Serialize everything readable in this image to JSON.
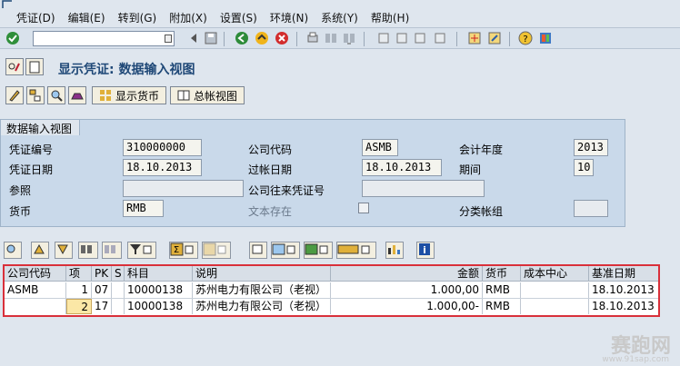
{
  "menu": [
    "凭证(D)",
    "编辑(E)",
    "转到(G)",
    "附加(X)",
    "设置(S)",
    "环境(N)",
    "系统(Y)",
    "帮助(H)"
  ],
  "command_field": {
    "value": ""
  },
  "title": "显示凭证: 数据输入视图",
  "app_toolbar": {
    "display_currency_label": "显示货币",
    "general_ledger_view_label": "总帐视图"
  },
  "header": {
    "tab_label": "数据输入视图",
    "doc_number_label": "凭证编号",
    "doc_number": "310000000",
    "company_code_label": "公司代码",
    "company_code": "ASMB",
    "fiscal_year_label": "会计年度",
    "fiscal_year": "2013",
    "doc_date_label": "凭证日期",
    "doc_date": "18.10.2013",
    "posting_date_label": "过帐日期",
    "posting_date": "18.10.2013",
    "period_label": "期间",
    "period": "10",
    "reference_label": "参照",
    "reference": "",
    "intercompany_label": "公司往来凭证号",
    "intercompany": "",
    "currency_label": "货币",
    "currency": "RMB",
    "text_exists_label": "文本存在",
    "ledger_group_label": "分类帐组",
    "ledger_group": ""
  },
  "grid": {
    "columns": [
      "公司代码",
      "项",
      "PK",
      "S",
      "科目",
      "说明",
      "金额",
      "货币",
      "成本中心",
      "基准日期"
    ],
    "rows": [
      [
        "ASMB",
        "1",
        "07",
        "",
        "10000138",
        "苏州电力有限公司（老视）",
        "1.000,00",
        "RMB",
        "",
        "18.10.2013"
      ],
      [
        "",
        "2",
        "17",
        "",
        "10000138",
        "苏州电力有限公司（老视）",
        "1.000,00-",
        "RMB",
        "",
        "18.10.2013"
      ]
    ]
  },
  "watermark": {
    "text": "赛跑网",
    "url": "www.91sap.com"
  },
  "colors": {
    "highlight_border": "#d9303a",
    "title": "#1f4877",
    "panel": "#c9d9ea"
  }
}
